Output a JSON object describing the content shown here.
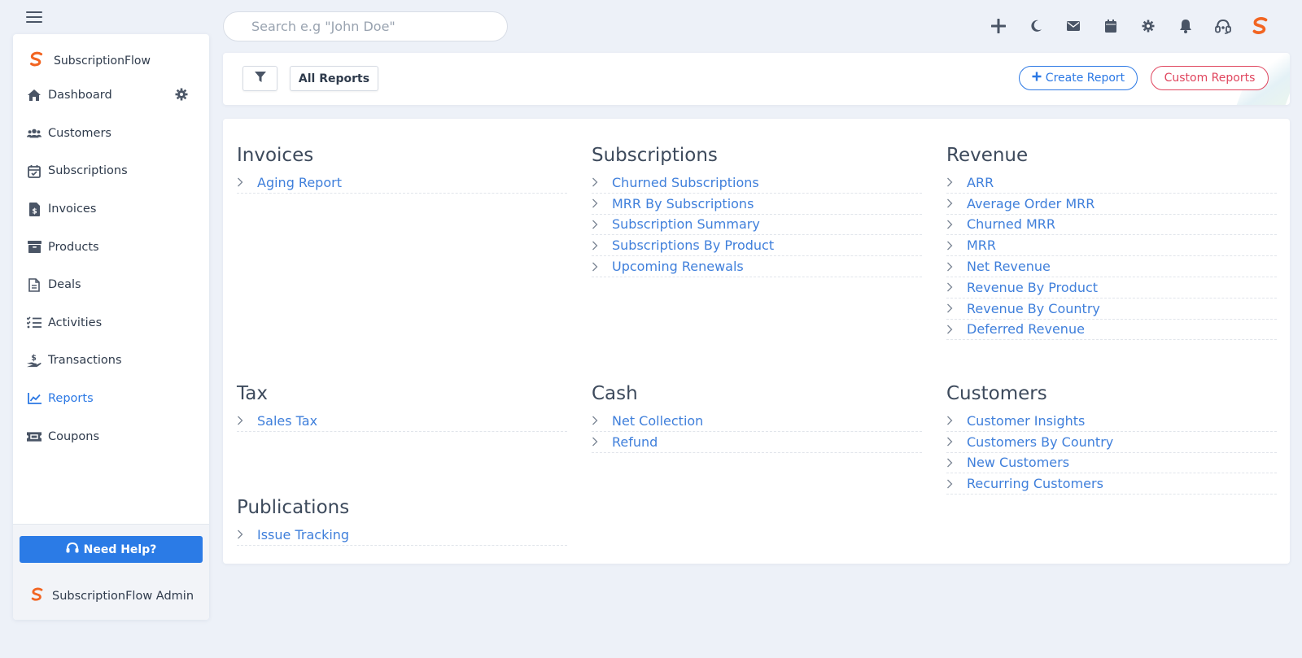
{
  "search": {
    "placeholder": "Search e.g \"John Doe\""
  },
  "sidebar": {
    "brand": "SubscriptionFlow",
    "items": [
      {
        "label": "Dashboard",
        "icon": "home-icon"
      },
      {
        "label": "Customers",
        "icon": "users-icon"
      },
      {
        "label": "Subscriptions",
        "icon": "calendar-check-icon"
      },
      {
        "label": "Invoices",
        "icon": "invoice-icon"
      },
      {
        "label": "Products",
        "icon": "archive-box-icon"
      },
      {
        "label": "Deals",
        "icon": "document-icon"
      },
      {
        "label": "Activities",
        "icon": "checklist-icon"
      },
      {
        "label": "Transactions",
        "icon": "hand-money-icon"
      },
      {
        "label": "Reports",
        "icon": "chart-line-icon",
        "active": true
      },
      {
        "label": "Coupons",
        "icon": "ticket-icon"
      }
    ],
    "help_label": "Need Help?",
    "admin_label": "SubscriptionFlow Admin"
  },
  "toolbar": {
    "all_reports_label": "All Reports",
    "create_report_label": "Create Report",
    "custom_reports_label": "Custom Reports"
  },
  "top_icons": [
    "plus-icon",
    "moon-icon",
    "mail-icon",
    "calendar-icon",
    "gear-icon",
    "bell-icon",
    "headset-icon",
    "brand-logo-icon"
  ],
  "colors": {
    "accent": "#2b78e4",
    "danger": "#e0455e",
    "link": "#3f7fdb",
    "logo": "#f26522"
  },
  "reports": {
    "invoices": {
      "title": "Invoices",
      "items": [
        "Aging Report"
      ]
    },
    "subscriptions": {
      "title": "Subscriptions",
      "items": [
        "Churned Subscriptions",
        "MRR By Subscriptions",
        "Subscription Summary",
        "Subscriptions By Product",
        "Upcoming Renewals"
      ]
    },
    "revenue": {
      "title": "Revenue",
      "items": [
        "ARR",
        "Average Order MRR",
        "Churned MRR",
        "MRR",
        "Net Revenue",
        "Revenue By Product",
        "Revenue By Country",
        "Deferred Revenue"
      ]
    },
    "tax": {
      "title": "Tax",
      "items": [
        "Sales Tax"
      ]
    },
    "cash": {
      "title": "Cash",
      "items": [
        "Net Collection",
        "Refund"
      ]
    },
    "customers": {
      "title": "Customers",
      "items": [
        "Customer Insights",
        "Customers By Country",
        "New Customers",
        "Recurring Customers"
      ]
    },
    "publications": {
      "title": "Publications",
      "items": [
        "Issue Tracking"
      ]
    }
  }
}
